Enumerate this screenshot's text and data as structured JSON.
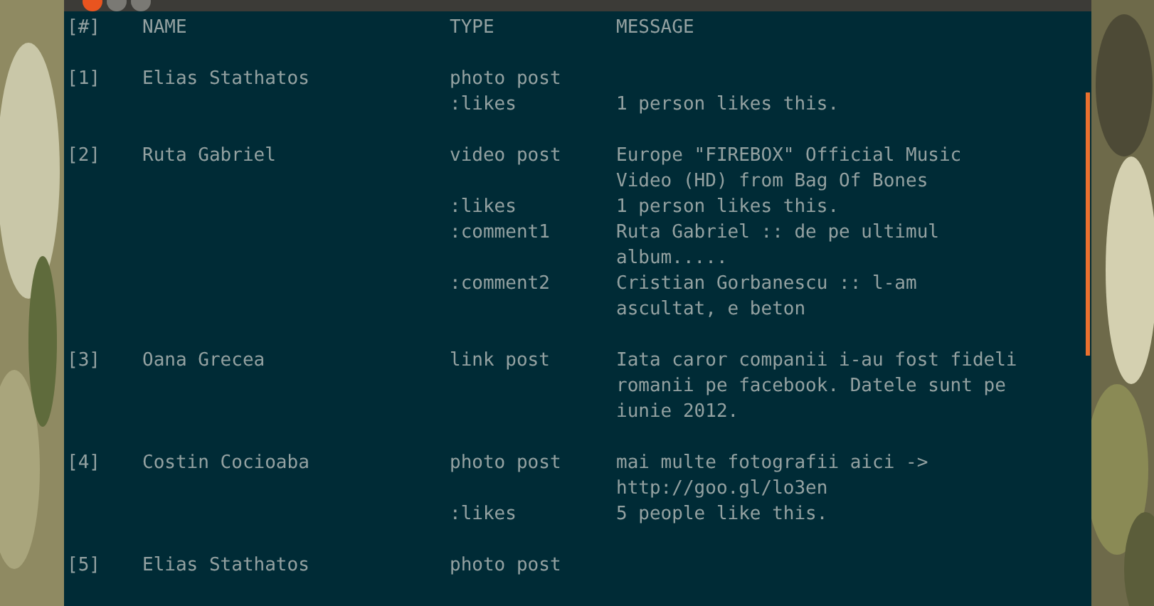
{
  "header": {
    "index": "[#]",
    "name": "NAME",
    "type": "TYPE",
    "message": "MESSAGE"
  },
  "posts": [
    {
      "index": "[1]",
      "name": "Elias Stathatos",
      "entries": [
        {
          "type": "photo post"
        },
        {
          "type": ":likes",
          "message": "1 person likes this."
        }
      ]
    },
    {
      "index": "[2]",
      "name": "Ruta Gabriel",
      "entries": [
        {
          "type": "video post",
          "message": "Europe \"FIREBOX\" Official Music Video (HD) from Bag Of Bones"
        },
        {
          "type": ":likes",
          "message": "1 person likes this."
        },
        {
          "type": ":comment1",
          "message": "Ruta Gabriel :: de pe ultimul album....."
        },
        {
          "type": ":comment2",
          "message": "Cristian Gorbanescu :: l-am ascultat, e beton"
        }
      ]
    },
    {
      "index": "[3]",
      "name": "Oana Grecea",
      "entries": [
        {
          "type": "link post",
          "message": "Iata caror companii i-au fost fideli romanii pe facebook. Datele sunt pe iunie 2012."
        }
      ]
    },
    {
      "index": "[4]",
      "name": "Costin Cocioaba",
      "entries": [
        {
          "type": "photo post",
          "message": "mai multe fotografii aici -> http://goo.gl/lo3en"
        },
        {
          "type": ":likes",
          "message": "5 people like this."
        }
      ]
    },
    {
      "index": "[5]",
      "name": "Elias Stathatos",
      "entries": [
        {
          "type": "photo post"
        }
      ]
    }
  ]
}
